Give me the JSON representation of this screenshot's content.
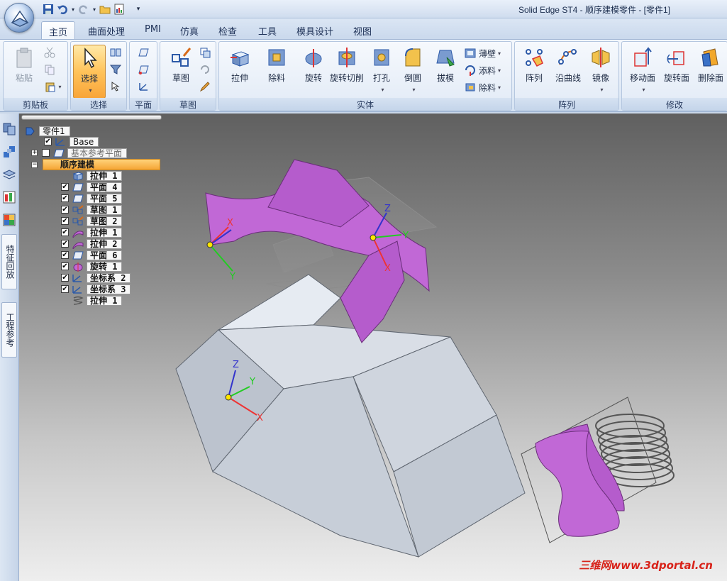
{
  "window": {
    "title": "Solid Edge ST4 - 顺序建模零件 - [零件1]"
  },
  "tabs": [
    "主页",
    "曲面处理",
    "PMI",
    "仿真",
    "检查",
    "工具",
    "模具设计",
    "视图"
  ],
  "ribbon": {
    "clipboard": {
      "label": "剪贴板",
      "paste": "粘贴"
    },
    "select": {
      "label": "选择",
      "select_btn": "选择"
    },
    "plane": {
      "label": "平面"
    },
    "sketch": {
      "label": "草图",
      "sketch_btn": "草图"
    },
    "solid": {
      "label": "实体",
      "buttons": [
        "拉伸",
        "除料",
        "旋转",
        "旋转切削",
        "打孔",
        "倒圆",
        "拔模"
      ],
      "small": [
        "薄壁",
        "添料",
        "除料"
      ]
    },
    "pattern": {
      "label": "阵列",
      "buttons": [
        "阵列",
        "沿曲线",
        "镜像"
      ]
    },
    "modify": {
      "label": "修改",
      "buttons": [
        "移动面",
        "旋转面",
        "删除面"
      ]
    }
  },
  "dock": {
    "tab_feature": "特征回放",
    "tab_ref": "工程参考"
  },
  "tree": {
    "root": "零件1",
    "base": "Base",
    "ref_planes": "基本参考平面",
    "sequential": "顺序建模",
    "items": [
      "拉伸 1",
      "平面 4",
      "平面 5",
      "草图 1",
      "草图 2",
      "拉伸 1",
      "拉伸 2",
      "平面 6",
      "旋转 1",
      "坐标系 2",
      "坐标系 3",
      "拉伸 1"
    ]
  },
  "axes": {
    "x": "X",
    "y": "Y",
    "z": "Z"
  },
  "watermark": "三维网www.3dportal.cn",
  "colors": {
    "accent_surface": "#c168d6",
    "solid_body": "#c7cfda",
    "selected_button": "#ffc35a"
  }
}
